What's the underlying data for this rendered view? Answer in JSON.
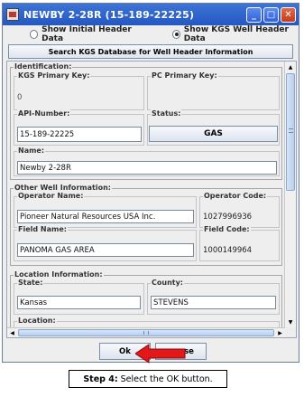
{
  "window": {
    "title": "NEWBY 2-28R (15-189-22225)",
    "minimize_label": "_",
    "maximize_label": "□",
    "close_label": "✕"
  },
  "header_options": {
    "initial_label": "Show Initial Header Data",
    "kgs_label": "Show KGS Well Header Data",
    "selected": "kgs"
  },
  "search_button_label": "Search KGS Database for Well Header Information",
  "identification": {
    "legend": "Identification:",
    "kgs_primary_key": {
      "label": "KGS Primary Key:",
      "value": "0"
    },
    "pc_primary_key": {
      "label": "PC Primary Key:",
      "value": ""
    },
    "api_number": {
      "label": "API-Number:",
      "value": "15-189-22225"
    },
    "status": {
      "label": "Status:",
      "value": "GAS"
    },
    "name": {
      "label": "Name:",
      "value": "Newby 2-28R"
    }
  },
  "other_well_info": {
    "legend": "Other Well Information:",
    "operator_name": {
      "label": "Operator Name:",
      "value": "Pioneer Natural Resources USA Inc."
    },
    "operator_code": {
      "label": "Operator Code:",
      "value": "1027996936"
    },
    "field_name": {
      "label": "Field Name:",
      "value": "PANOMA GAS AREA"
    },
    "field_code": {
      "label": "Field Code:",
      "value": "1000149964"
    }
  },
  "location_info": {
    "legend": "Location Information:",
    "state": {
      "label": "State:",
      "value": "Kansas"
    },
    "county": {
      "label": "County:",
      "value": "STEVENS"
    },
    "location": {
      "label": "Location:"
    }
  },
  "buttons": {
    "ok_label": "Ok",
    "close_label_visible": "se"
  },
  "scrollbars": {
    "up": "▲",
    "down": "▼",
    "left": "◀",
    "right": "▶"
  },
  "caption": {
    "step": "Step 4:",
    "text": "Select the OK button."
  },
  "colors": {
    "titlebar": "#2a5fcc",
    "arrow": "#e31818"
  }
}
